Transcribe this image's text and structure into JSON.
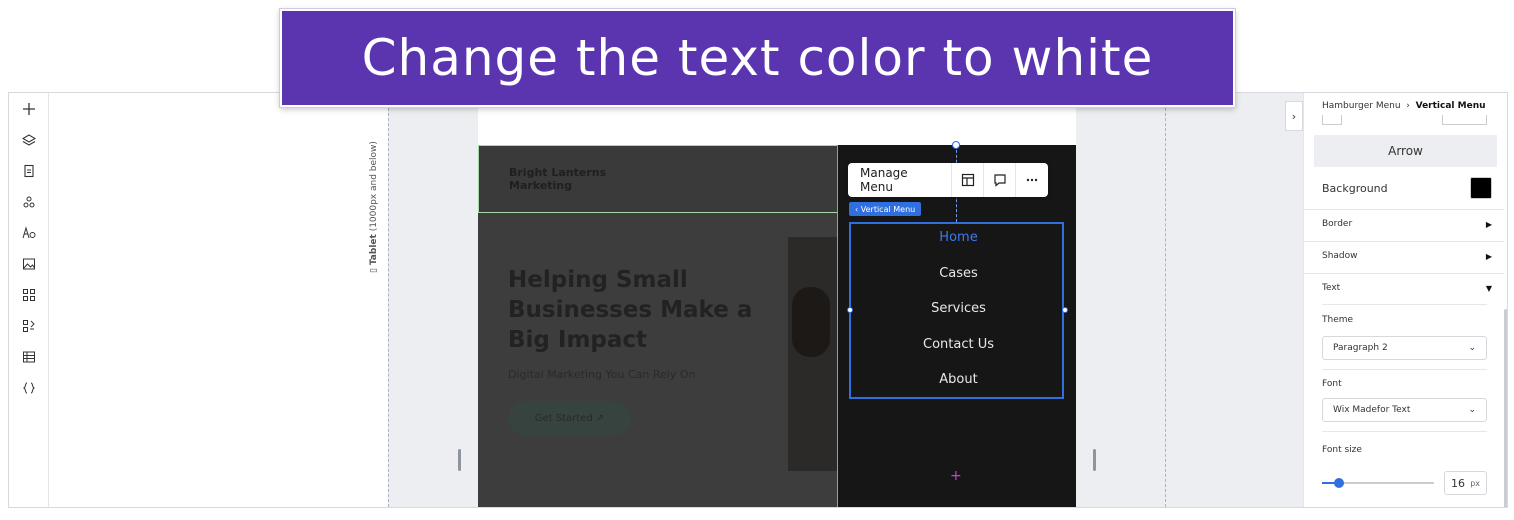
{
  "banner": {
    "text": "Change the text color to white"
  },
  "left_toolbar": {
    "tools": [
      "add-icon",
      "layers-icon",
      "pages-icon",
      "apps-icon",
      "text-theme-icon",
      "media-icon",
      "widgets-icon",
      "business-apps-icon",
      "table-icon",
      "code-icon"
    ]
  },
  "canvas": {
    "breakpoint_label_bold": "Tablet",
    "breakpoint_label": " (1000px and below)",
    "site": {
      "brand_line1": "Bright Lanterns",
      "brand_line2": "Marketing",
      "hero_title": "Helping Small Businesses Make a Big Impact",
      "hero_subtitle": "Digital Marketing You Can Rely On",
      "hero_button": "Get Started"
    },
    "floating_toolbar": {
      "manage_menu": "Manage Menu"
    },
    "selection_tag": "Vertical Menu",
    "menu_items": [
      "Home",
      "Cases",
      "Services",
      "Contact Us",
      "About"
    ]
  },
  "panel": {
    "breadcrumb_parent": "Hamburger Menu",
    "breadcrumb_sep": "›",
    "breadcrumb_current": "Vertical Menu",
    "arrow_button": "Arrow",
    "background_label": "Background",
    "background_color": "#000000",
    "border_label": "Border",
    "shadow_label": "Shadow",
    "text_label": "Text",
    "theme_label": "Theme",
    "theme_value": "Paragraph 2",
    "font_label": "Font",
    "font_value": "Wix Madefor Text",
    "font_size_label": "Font size",
    "font_size_value": "16",
    "font_size_unit": "px"
  },
  "colors": {
    "banner": "#5b35b0",
    "accent": "#2f6fe0",
    "menu_bg": "#161616"
  }
}
